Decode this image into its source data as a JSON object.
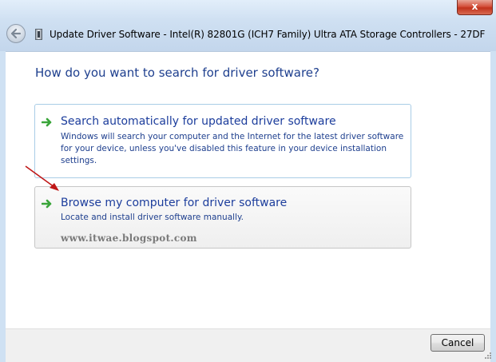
{
  "window": {
    "title": "Update Driver Software - Intel(R) 82801G (ICH7 Family) Ultra ATA Storage Controllers - 27DF",
    "close_label": "x"
  },
  "main": {
    "heading": "How do you want to search for driver software?",
    "options": [
      {
        "title": "Search automatically for updated driver software",
        "description": "Windows will search your computer and the Internet for the latest driver software for your device, unless you've disabled this feature in your device installation settings.",
        "icon": "green-arrow-icon"
      },
      {
        "title": "Browse my computer for driver software",
        "description": "Locate and install driver software manually.",
        "icon": "green-arrow-icon"
      }
    ],
    "watermark": "www.itwae.blogspot.com"
  },
  "footer": {
    "cancel_label": "Cancel"
  },
  "colors": {
    "heading": "#1e3f8e",
    "link_title": "#1c3d9c",
    "option_hover_border": "#a9cde6",
    "arrow_green": "#3aa53a",
    "annotation_red": "#c01818",
    "close_red": "#c1321c"
  }
}
